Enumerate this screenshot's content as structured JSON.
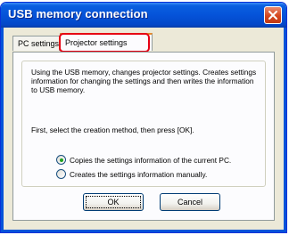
{
  "window": {
    "title": "USB memory connection"
  },
  "tabs": [
    {
      "label": "PC settings"
    },
    {
      "label": "Projector settings"
    }
  ],
  "content": {
    "description": "Using the USB memory, changes projector settings. Creates settings information for changing the settings and then writes the information to USB memory.",
    "instruction": "First, select the creation method, then press [OK].",
    "options": [
      {
        "label": "Copies the settings information of the current PC.",
        "selected": true
      },
      {
        "label": "Creates the settings information manually.",
        "selected": false
      }
    ]
  },
  "buttons": {
    "ok": "OK",
    "cancel": "Cancel"
  },
  "colors": {
    "titlebar": "#0553d9",
    "close_button": "#d5471f",
    "tab_highlight": "#e60012",
    "radio_selected": "#21a121"
  }
}
